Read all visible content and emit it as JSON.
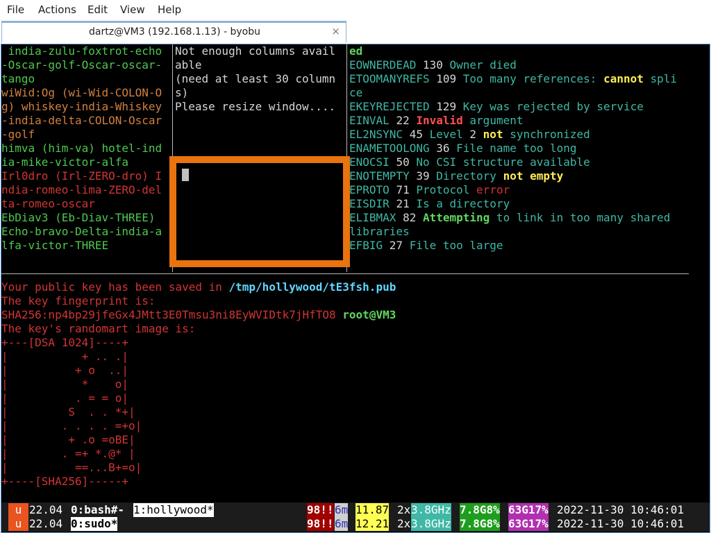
{
  "menu": [
    "File",
    "Actions",
    "Edit",
    "View",
    "Help"
  ],
  "tab": {
    "title": "dartz@VM3 (192.168.1.13) - byobu",
    "close": "×"
  },
  "pane_left": [
    {
      "cls": "g",
      "text": " india-zulu-foxtrot-echo"
    },
    {
      "cls": "g",
      "text": "-Oscar-golf-Oscar-oscar-"
    },
    {
      "cls": "g",
      "text": "tango"
    },
    {
      "cls": "o",
      "text": "wiWid:Og (wi-Wid-COLON-O"
    },
    {
      "cls": "o",
      "text": "g) whiskey-india-Whiskey"
    },
    {
      "cls": "o",
      "text": "-india-delta-COLON-Oscar"
    },
    {
      "cls": "o",
      "text": "-golf"
    },
    {
      "cls": "g",
      "text": "himva (him-va) hotel-ind"
    },
    {
      "cls": "g",
      "text": "ia-mike-victor-alfa"
    },
    {
      "cls": "r",
      "text": "Irl0dro (Irl-ZERO-dro) I"
    },
    {
      "cls": "r",
      "text": "ndia-romeo-lima-ZERO-del"
    },
    {
      "cls": "r",
      "text": "ta-romeo-oscar"
    },
    {
      "cls": "g",
      "text": "EbDiav3 (Eb-Diav-THREE)"
    },
    {
      "cls": "g",
      "text": "Echo-bravo-Delta-india-a"
    },
    {
      "cls": "g",
      "text": "lfa-victor-THREE"
    }
  ],
  "pane_middle": [
    "Not enough columns avail",
    "able",
    "(need at least 30 column",
    "s)",
    "Please resize window...."
  ],
  "pane_right": [
    [
      {
        "cls": "gb",
        "text": "ed"
      }
    ],
    [
      {
        "cls": "c",
        "text": "EOWNERDEAD "
      },
      {
        "cls": "w",
        "text": "130 "
      },
      {
        "cls": "c",
        "text": "Owner died"
      }
    ],
    [
      {
        "cls": "c",
        "text": "ETOOMANYREFS "
      },
      {
        "cls": "w",
        "text": "109 "
      },
      {
        "cls": "c",
        "text": "Too many references: "
      },
      {
        "cls": "yb",
        "text": "cannot"
      },
      {
        "cls": "c",
        "text": " spli"
      }
    ],
    [
      {
        "cls": "c",
        "text": "ce"
      }
    ],
    [
      {
        "cls": "c",
        "text": "EKEYREJECTED "
      },
      {
        "cls": "w",
        "text": "129 "
      },
      {
        "cls": "c",
        "text": "Key was rejected by service"
      }
    ],
    [
      {
        "cls": "c",
        "text": "EINVAL "
      },
      {
        "cls": "w",
        "text": "22 "
      },
      {
        "cls": "rb",
        "text": "Invalid"
      },
      {
        "cls": "c",
        "text": " argument"
      }
    ],
    [
      {
        "cls": "c",
        "text": "EL2NSYNC "
      },
      {
        "cls": "w",
        "text": "45 "
      },
      {
        "cls": "c",
        "text": "Level "
      },
      {
        "cls": "w",
        "text": "2 "
      },
      {
        "cls": "yb",
        "text": "not"
      },
      {
        "cls": "c",
        "text": " synchronized"
      }
    ],
    [
      {
        "cls": "c",
        "text": "ENAMETOOLONG "
      },
      {
        "cls": "w",
        "text": "36 "
      },
      {
        "cls": "c",
        "text": "File name too long"
      }
    ],
    [
      {
        "cls": "c",
        "text": "ENOCSI "
      },
      {
        "cls": "w",
        "text": "50 "
      },
      {
        "cls": "c",
        "text": "No CSI structure available"
      }
    ],
    [
      {
        "cls": "c",
        "text": "ENOTEMPTY "
      },
      {
        "cls": "w",
        "text": "39 "
      },
      {
        "cls": "c",
        "text": "Directory "
      },
      {
        "cls": "yb",
        "text": "not empty"
      }
    ],
    [
      {
        "cls": "c",
        "text": "EPROTO "
      },
      {
        "cls": "w",
        "text": "71 "
      },
      {
        "cls": "c",
        "text": "Protocol "
      },
      {
        "cls": "r",
        "text": "error"
      }
    ],
    [
      {
        "cls": "c",
        "text": "EISDIR "
      },
      {
        "cls": "w",
        "text": "21 "
      },
      {
        "cls": "c",
        "text": "Is a directory"
      }
    ],
    [
      {
        "cls": "c",
        "text": "ELIBMAX "
      },
      {
        "cls": "w",
        "text": "82 "
      },
      {
        "cls": "gb",
        "text": "Attempting"
      },
      {
        "cls": "c",
        "text": " to link in too many shared"
      }
    ],
    [
      {
        "cls": "c",
        "text": "libraries"
      }
    ],
    [
      {
        "cls": "c",
        "text": "EFBIG "
      },
      {
        "cls": "w",
        "text": "27 "
      },
      {
        "cls": "c",
        "text": "File too large"
      }
    ]
  ],
  "pane_bottom": [
    [
      {
        "cls": "r",
        "text": "Your public key has been saved in "
      },
      {
        "cls": "cb",
        "text": "/tmp/hollywood/tE3fsh.pub"
      }
    ],
    [
      {
        "cls": "r",
        "text": "The key fingerprint is:"
      }
    ],
    [
      {
        "cls": "r",
        "text": "SHA256:np4bp29jfeGx4JMtt3E0Tmsu3ni8EyWVIDtk7jHfTO8 "
      },
      {
        "cls": "gb",
        "text": "root@VM3"
      }
    ],
    [
      {
        "cls": "r",
        "text": "The key's randomart image is:"
      }
    ],
    [
      {
        "cls": "r",
        "text": "+---[DSA 1024]----+"
      }
    ],
    [
      {
        "cls": "r",
        "text": "|           + .. .|"
      }
    ],
    [
      {
        "cls": "r",
        "text": "|          + o  ..|"
      }
    ],
    [
      {
        "cls": "r",
        "text": "|           *    o|"
      }
    ],
    [
      {
        "cls": "r",
        "text": "|          . = = o|"
      }
    ],
    [
      {
        "cls": "r",
        "text": "|         S  . . *+|"
      }
    ],
    [
      {
        "cls": "r",
        "text": "|        . . . . =+o|"
      }
    ],
    [
      {
        "cls": "r",
        "text": "|         + .o =oBE|"
      }
    ],
    [
      {
        "cls": "r",
        "text": "|        . =+ *.@* |"
      }
    ],
    [
      {
        "cls": "r",
        "text": "|          ==...B+=o|"
      }
    ],
    [
      {
        "cls": "r",
        "text": "+----[SHA256]-----+"
      }
    ]
  ],
  "status": {
    "rows": [
      {
        "logo": "u",
        "release": "22.04",
        "win0": "0:bash#-",
        "win1": "1:hollywood*",
        "updates": "98!!",
        "uptime": "6m",
        "load": "11.87",
        "cpus": "2x",
        "freq": "3.8GHz",
        "mem": "7.8G8%",
        "disk": "63G17%",
        "datetime": "2022-11-30 10:46:01"
      },
      {
        "logo": "u",
        "release": "22.04",
        "win0": "0:sudo*",
        "win1": "",
        "updates": "98!!",
        "uptime": "6m",
        "load": "12.21",
        "cpus": "2x",
        "freq": "3.8GHz",
        "mem": "7.8G8%",
        "disk": "63G17%",
        "datetime": "2022-11-30 10:46:01"
      }
    ]
  },
  "colors": {
    "terminal_bg": "#000000",
    "overlay_border": "#e8730f",
    "logo_bg": "#e95420",
    "updates_bg": "#a00000",
    "load_bg": "#ffff55",
    "freq_bg": "#3fb8a6",
    "mem_bg": "#1e9e1e",
    "disk_bg": "#b030b0"
  }
}
